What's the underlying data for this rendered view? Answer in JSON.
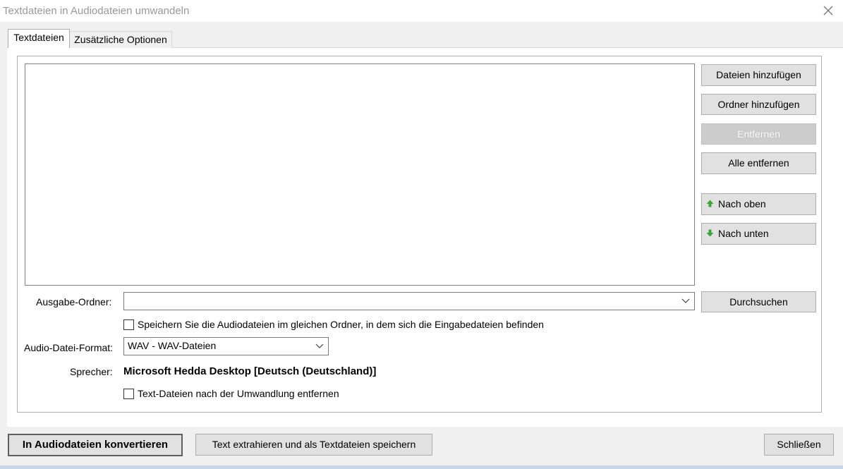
{
  "window": {
    "title": "Textdateien in Audiodateien umwandeln",
    "close_icon": "close-icon"
  },
  "tabs": [
    {
      "label": "Textdateien",
      "active": true
    },
    {
      "label": "Zusätzliche Optionen",
      "active": false
    }
  ],
  "file_list": {
    "items": []
  },
  "side_buttons": {
    "add_files": "Dateien hinzufügen",
    "add_folder": "Ordner hinzufügen",
    "remove": "Entfernen",
    "remove_all": "Alle entfernen",
    "move_up": "Nach oben",
    "move_down": "Nach unten"
  },
  "output": {
    "label": "Ausgabe-Ordner:",
    "value": "",
    "browse": "Durchsuchen",
    "same_folder_label": "Speichern Sie die Audiodateien im gleichen Ordner, in dem sich die Eingabedateien befinden",
    "same_folder_checked": false
  },
  "format": {
    "label": "Audio-Datei-Format:",
    "selected": "WAV - WAV-Dateien"
  },
  "speaker": {
    "label": "Sprecher:",
    "value": "Microsoft Hedda Desktop [Deutsch (Deutschland)]"
  },
  "delete_text_files": {
    "label": "Text-Dateien nach der Umwandlung entfernen",
    "checked": false
  },
  "footer": {
    "convert": "In Audiodateien konvertieren",
    "extract": "Text extrahieren und als Textdateien speichern",
    "close": "Schließen"
  },
  "colors": {
    "arrow_green": "#3fa33f",
    "disabled_button": "#cccccc"
  }
}
